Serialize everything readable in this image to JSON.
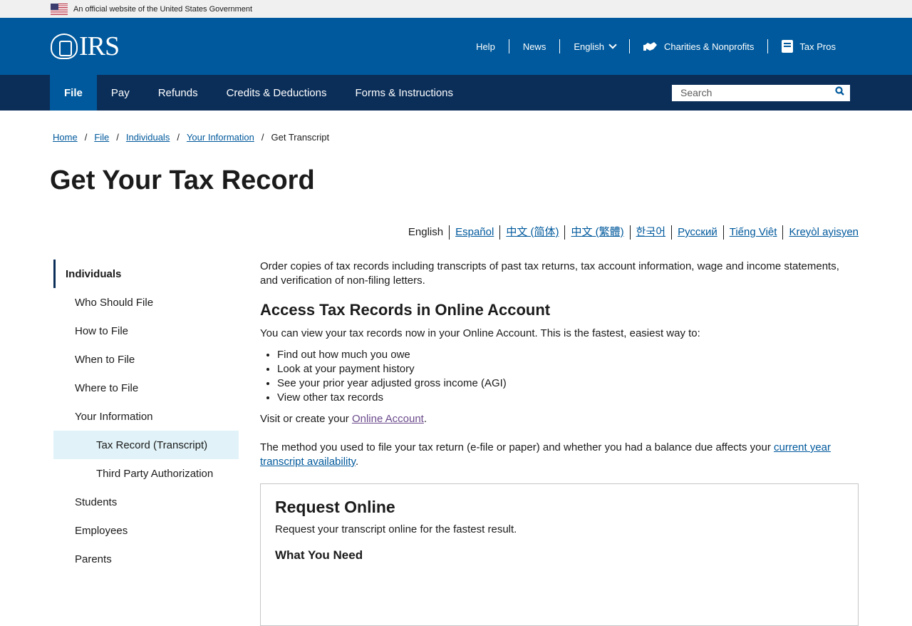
{
  "gov_banner": {
    "text": "An official website of the United States Government"
  },
  "header": {
    "logo_text": "IRS",
    "help": "Help",
    "news": "News",
    "language": "English",
    "charities": "Charities & Nonprofits",
    "tax_pros": "Tax Pros"
  },
  "nav": {
    "items": [
      "File",
      "Pay",
      "Refunds",
      "Credits & Deductions",
      "Forms & Instructions"
    ],
    "search_placeholder": "Search"
  },
  "breadcrumb": [
    "Home",
    "File",
    "Individuals",
    "Your Information",
    "Get Transcript"
  ],
  "page_title": "Get Your Tax Record",
  "languages": [
    "English",
    "Español",
    "中文 (简体)",
    "中文 (繁體)",
    "한국어",
    "Русский",
    "Tiếng Việt",
    "Kreyòl ayisyen"
  ],
  "sidebar": {
    "heading": "Individuals",
    "items": [
      "Who Should File",
      "How to File",
      "When to File",
      "Where to File",
      "Your Information"
    ],
    "sub_items": [
      "Tax Record (Transcript)",
      "Third Party Authorization"
    ],
    "more_items": [
      "Students",
      "Employees",
      "Parents"
    ]
  },
  "content": {
    "intro": "Order copies of tax records including transcripts of past tax returns, tax account information, wage and income statements, and verification of non-filing letters.",
    "h2": "Access Tax Records in Online Account",
    "lead": "You can view your tax records now in your Online Account. This is the fastest, easiest way to:",
    "bullets": [
      "Find out how much you owe",
      "Look at your payment history",
      "See your prior year adjusted gross income (AGI)",
      "View other tax records"
    ],
    "visit_prefix": "Visit or create your ",
    "visit_link": "Online Account",
    "visit_suffix": ".",
    "method_text": "The method you used to file your tax return (e-file or paper) and whether you had a balance due affects  your ",
    "method_link": "current year transcript availability",
    "method_suffix": ".",
    "card_title": "Request Online",
    "card_text": "Request your transcript online for the fastest result.",
    "card_subhead": "What You Need"
  }
}
